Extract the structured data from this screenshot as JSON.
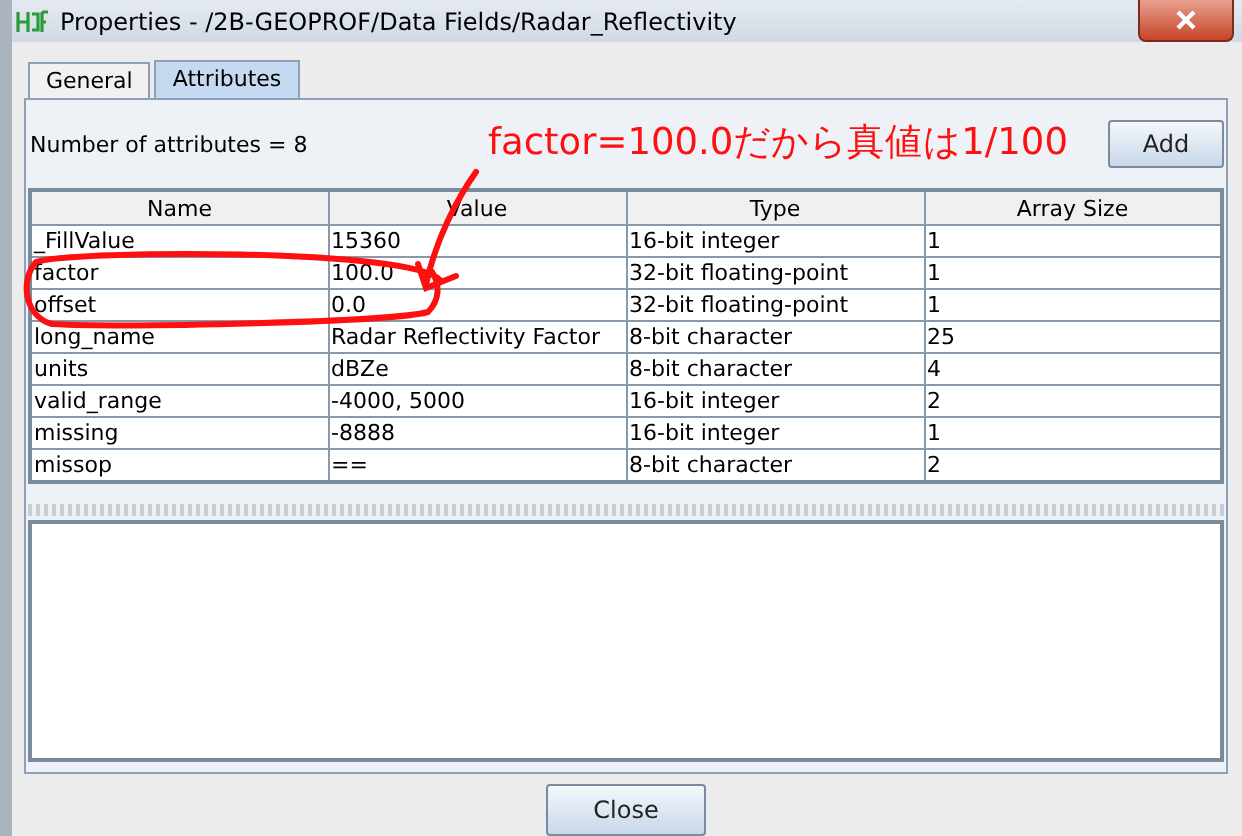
{
  "window": {
    "title": "Properties - /2B-GEOPROF/Data Fields/Radar_Reflectivity"
  },
  "tabs": [
    {
      "label": "General",
      "selected": false
    },
    {
      "label": "Attributes",
      "selected": true
    }
  ],
  "count_label": "Number of attributes = 8",
  "add_button": "Add",
  "table": {
    "columns": [
      "Name",
      "Value",
      "Type",
      "Array Size"
    ],
    "rows": [
      [
        "_FillValue",
        "15360",
        "16-bit integer",
        "1"
      ],
      [
        "factor",
        "100.0",
        "32-bit floating-point",
        "1"
      ],
      [
        "offset",
        "0.0",
        "32-bit floating-point",
        "1"
      ],
      [
        "long_name",
        "Radar Reflectivity Factor",
        "8-bit character",
        "25"
      ],
      [
        "units",
        "dBZe",
        "8-bit character",
        "4"
      ],
      [
        "valid_range",
        "-4000, 5000",
        "16-bit integer",
        "2"
      ],
      [
        "missing",
        "-8888",
        "16-bit integer",
        "1"
      ],
      [
        "missop",
        "==",
        "8-bit character",
        "2"
      ]
    ]
  },
  "annotation": "factor=100.0だから真値は1/100",
  "close_button": "Close"
}
